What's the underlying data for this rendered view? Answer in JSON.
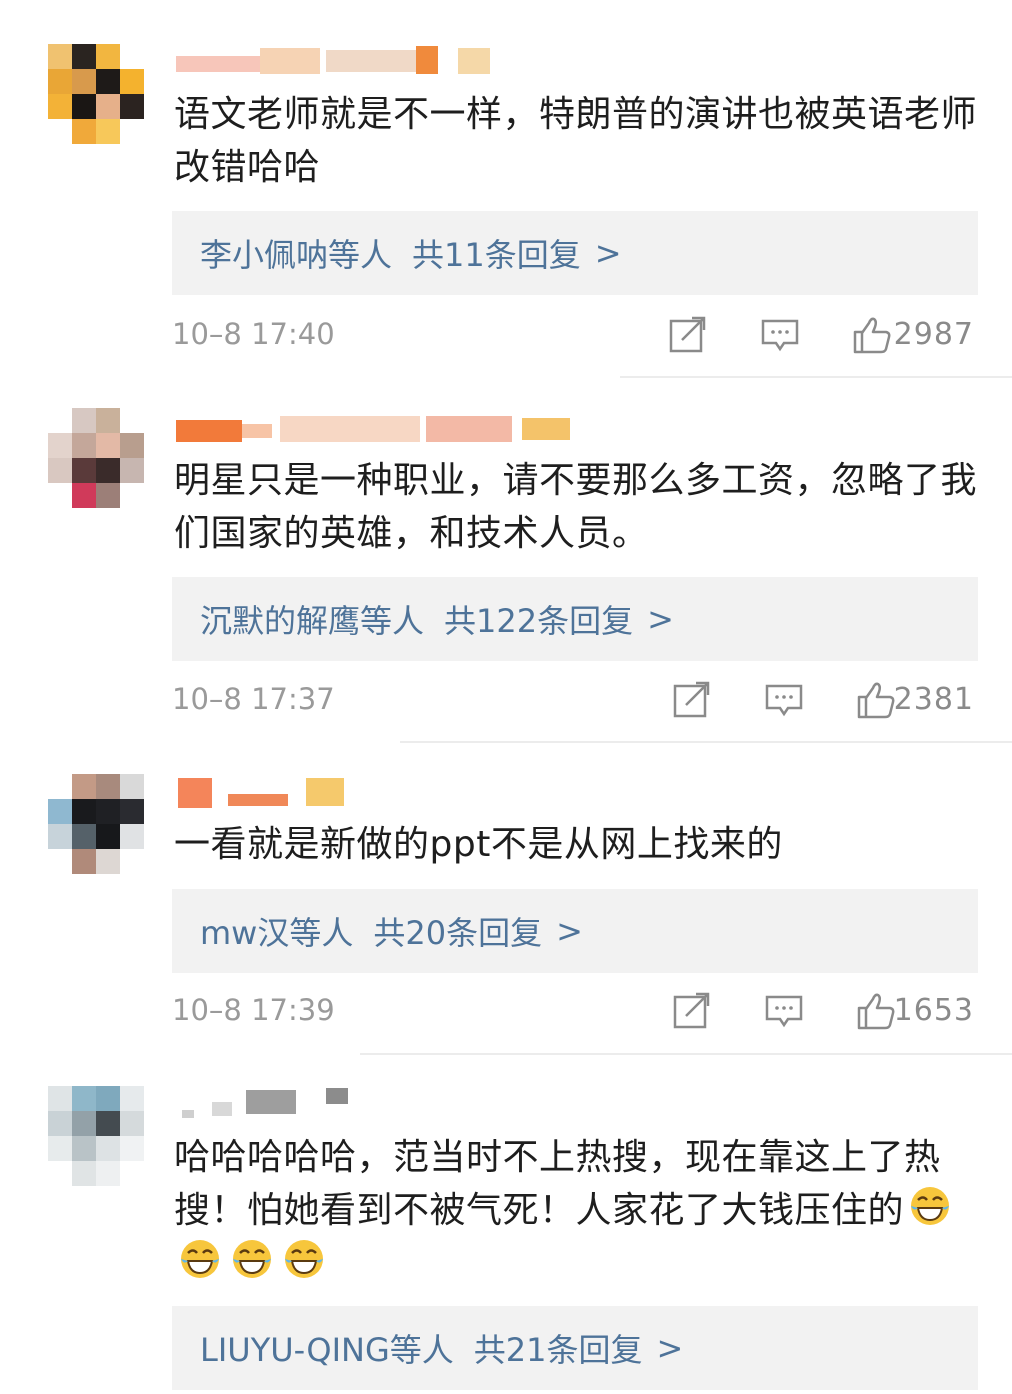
{
  "comments": [
    {
      "text": "语文老师就是不一样，特朗普的演讲也被英语老师改错哈哈",
      "reply_who": "李小佩呐等人",
      "reply_count": "共11条回复",
      "reply_arrow": ">",
      "time": "10–8 17:40",
      "likes": "2987"
    },
    {
      "text": "明星只是一种职业，请不要那么多工资，忽略了我们国家的英雄，和技术人员。",
      "reply_who": "沉默的解鹰等人",
      "reply_count": "共122条回复",
      "reply_arrow": ">",
      "time": "10–8 17:37",
      "likes": "2381"
    },
    {
      "text": "一看就是新做的ppt不是从网上找来的",
      "reply_who": "mw汉等人",
      "reply_count": "共20条回复",
      "reply_arrow": ">",
      "time": "10–8 17:39",
      "likes": "1653"
    },
    {
      "text": "哈哈哈哈哈，范当时不上热搜，现在靠这上了热搜！怕她看到不被气死！人家花了大钱压住的",
      "emoji": "laughing-crying-emoji",
      "reply_who": "LIUYU-QING等人",
      "reply_count": "共21条回复",
      "reply_arrow": ">"
    }
  ],
  "icons": {
    "repost": "share-edit-icon",
    "comment": "comment-bubble-icon",
    "like": "thumbs-up-icon"
  },
  "colors": {
    "reply_link": "#4e7399",
    "reply_bg": "#f2f2f2",
    "meta_gray": "#9a9a9a"
  }
}
